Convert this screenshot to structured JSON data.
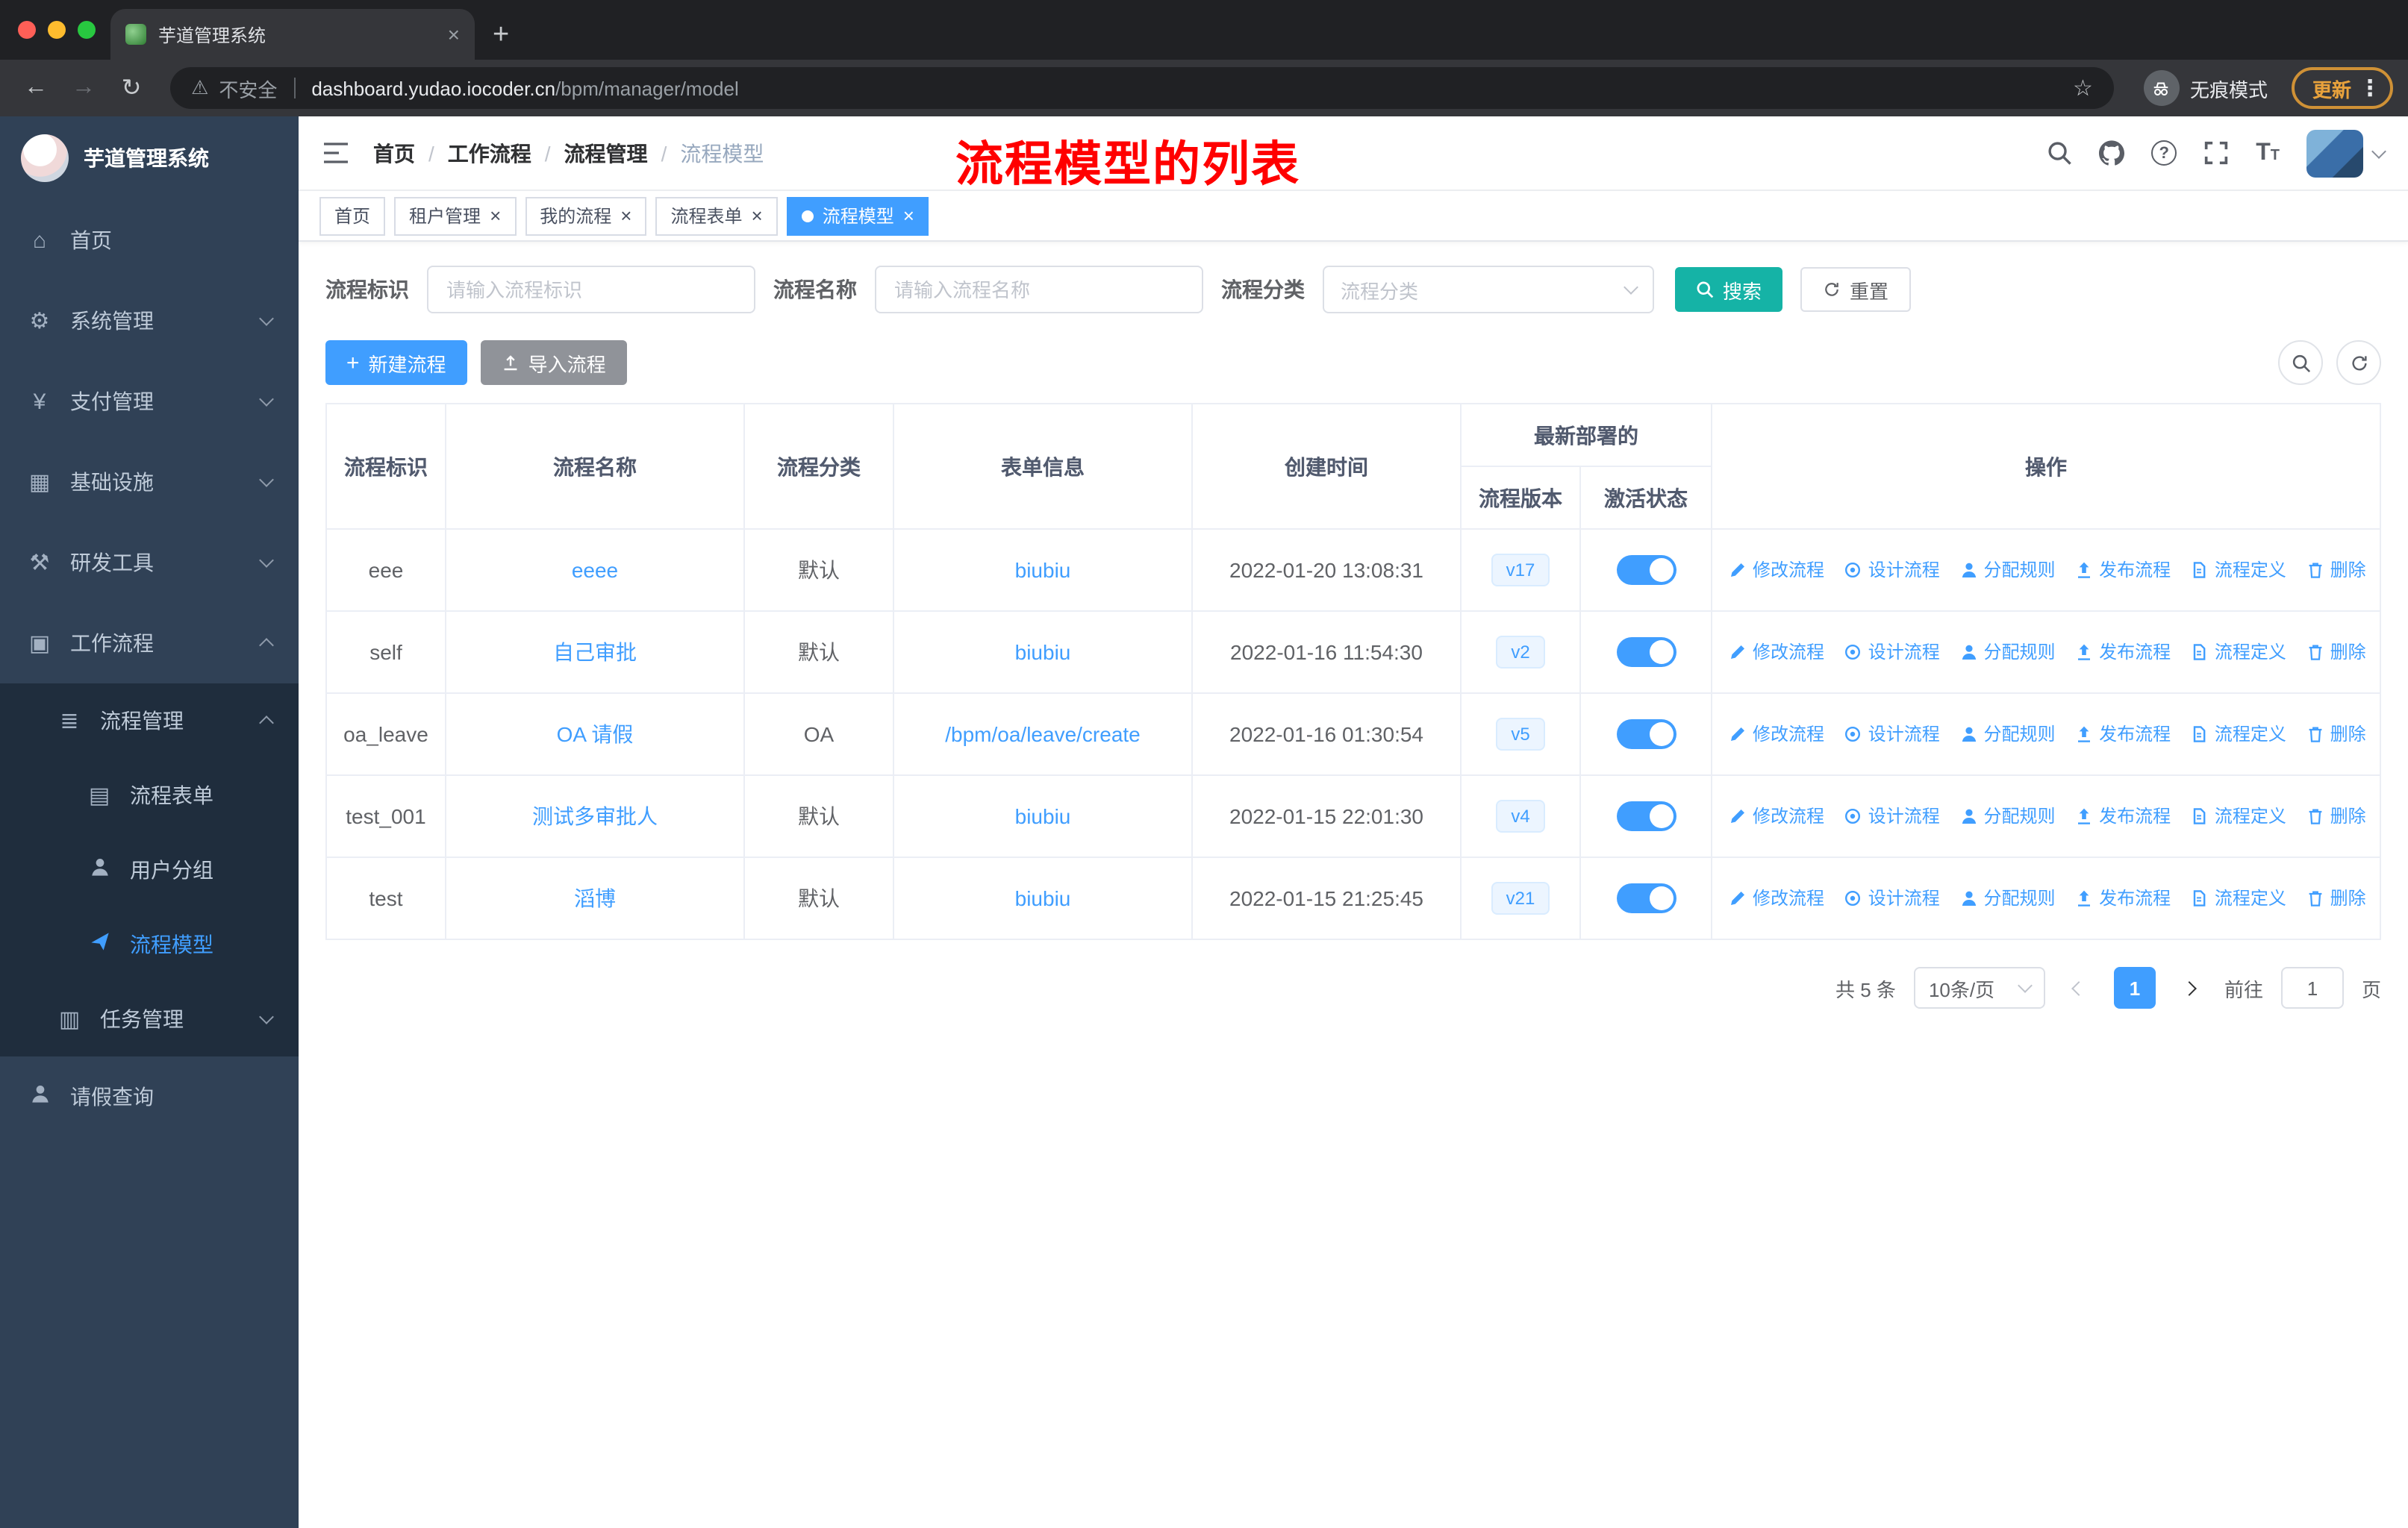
{
  "browser": {
    "tab_title": "芋道管理系统",
    "security_label": "不安全",
    "url_host": "dashboard.yudao.iocoder.cn",
    "url_path": "/bpm/manager/model",
    "incognito_label": "无痕模式",
    "update_label": "更新"
  },
  "icons": {
    "close": "×",
    "new_tab": "+",
    "back": "←",
    "forward": "→",
    "reload": "↻",
    "warning": "⚠",
    "star": "☆",
    "kebab": "⋮",
    "home": "⌂",
    "gear": "⚙",
    "yen": "¥",
    "infrastructure": "▦",
    "tools": "⚒",
    "workflow": "▣",
    "process_management": "≣",
    "process_form": "▤",
    "task_management": "▥",
    "plus": "+",
    "question": "?"
  },
  "sidebar": {
    "logo_title": "芋道管理系统",
    "items": [
      {
        "label": "首页"
      },
      {
        "label": "系统管理"
      },
      {
        "label": "支付管理"
      },
      {
        "label": "基础设施"
      },
      {
        "label": "研发工具"
      },
      {
        "label": "工作流程"
      }
    ],
    "workflow_children": {
      "process_management": "流程管理",
      "process_management_children": [
        "流程表单",
        "用户分组",
        "流程模型"
      ],
      "task_management": "任务管理"
    },
    "leave_query": "请假查询"
  },
  "header": {
    "breadcrumb": [
      "首页",
      "工作流程",
      "流程管理",
      "流程模型"
    ],
    "separator": "/",
    "annotation": "流程模型的列表"
  },
  "tags": [
    {
      "label": "首页"
    },
    {
      "label": "租户管理"
    },
    {
      "label": "我的流程"
    },
    {
      "label": "流程表单"
    },
    {
      "label": "流程模型"
    }
  ],
  "filters": {
    "id_label": "流程标识",
    "id_placeholder": "请输入流程标识",
    "name_label": "流程名称",
    "name_placeholder": "请输入流程名称",
    "category_label": "流程分类",
    "category_placeholder": "流程分类",
    "search_button": "搜索",
    "reset_button": "重置"
  },
  "toolbar": {
    "create_button": "新建流程",
    "import_button": "导入流程"
  },
  "table": {
    "headers": {
      "id": "流程标识",
      "name": "流程名称",
      "category": "流程分类",
      "form": "表单信息",
      "created": "创建时间",
      "deploy_group": "最新部署的",
      "version": "流程版本",
      "active": "激活状态",
      "actions": "操作"
    },
    "action_labels": [
      "修改流程",
      "设计流程",
      "分配规则",
      "发布流程",
      "流程定义",
      "删除"
    ],
    "rows": [
      {
        "id": "eee",
        "name": "eeee",
        "category": "默认",
        "form": "biubiu",
        "created": "2022-01-20 13:08:31",
        "version": "v17"
      },
      {
        "id": "self",
        "name": "自己审批",
        "category": "默认",
        "form": "biubiu",
        "created": "2022-01-16 11:54:30",
        "version": "v2"
      },
      {
        "id": "oa_leave",
        "name": "OA 请假",
        "category": "OA",
        "form": "/bpm/oa/leave/create",
        "created": "2022-01-16 01:30:54",
        "version": "v5"
      },
      {
        "id": "test_001",
        "name": "测试多审批人",
        "category": "默认",
        "form": "biubiu",
        "created": "2022-01-15 22:01:30",
        "version": "v4"
      },
      {
        "id": "test",
        "name": "滔博",
        "category": "默认",
        "form": "biubiu",
        "created": "2022-01-15 21:25:45",
        "version": "v21"
      }
    ]
  },
  "pagination": {
    "total": "共 5 条",
    "page_size": "10条/页",
    "current_page": "1",
    "goto_label": "前往",
    "goto_value": "1",
    "page_label": "页"
  },
  "colors": {
    "accent": "#409eff",
    "search_button": "#15b3a6",
    "annotation": "#ff0000",
    "sidebar_bg": "#304156",
    "sidebar_submenu_bg": "#1f2d3d"
  }
}
